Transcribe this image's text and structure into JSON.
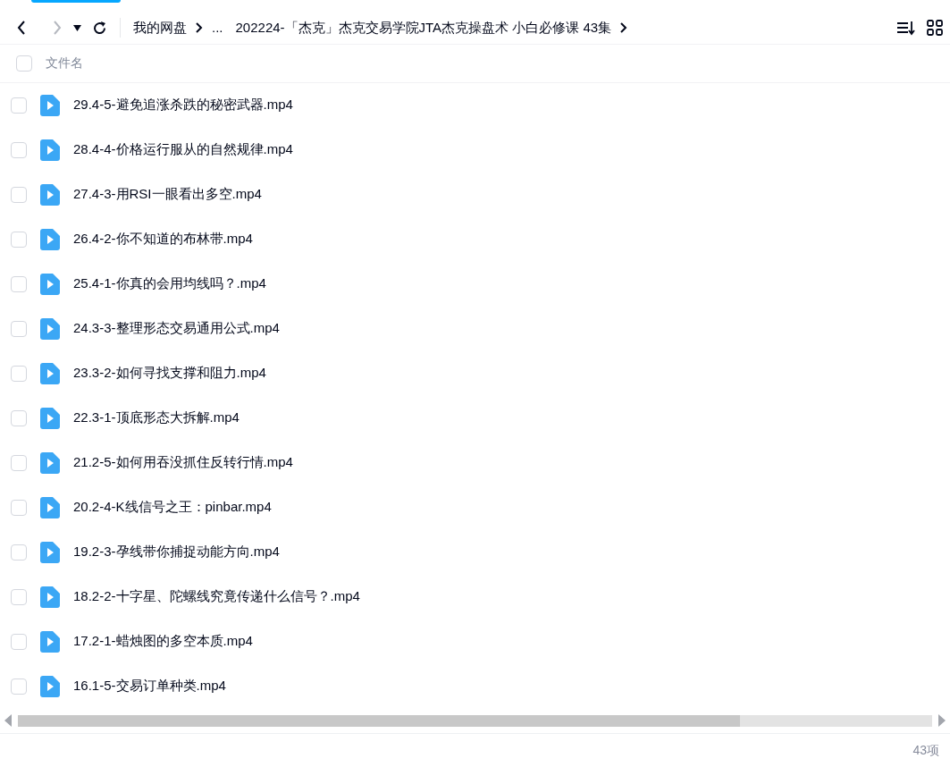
{
  "breadcrumb": [
    {
      "kind": "link",
      "label": "我的网盘"
    },
    {
      "kind": "ellipsis",
      "label": "..."
    },
    {
      "kind": "link",
      "label": "202224-「杰克」杰克交易学院JTA杰克操盘术 小白必修课 43集"
    }
  ],
  "header": {
    "checked": false,
    "column": "文件名"
  },
  "files": [
    {
      "name": "29.4-5-避免追涨杀跌的秘密武器.mp4",
      "checked": false
    },
    {
      "name": "28.4-4-价格运行服从的自然规律.mp4",
      "checked": false
    },
    {
      "name": "27.4-3-用RSI一眼看出多空.mp4",
      "checked": false
    },
    {
      "name": "26.4-2-你不知道的布林带.mp4",
      "checked": false
    },
    {
      "name": "25.4-1-你真的会用均线吗？.mp4",
      "checked": false
    },
    {
      "name": "24.3-3-整理形态交易通用公式.mp4",
      "checked": false
    },
    {
      "name": "23.3-2-如何寻找支撑和阻力.mp4",
      "checked": false
    },
    {
      "name": "22.3-1-顶底形态大拆解.mp4",
      "checked": false
    },
    {
      "name": "21.2-5-如何用吞没抓住反转行情.mp4",
      "checked": false
    },
    {
      "name": "20.2-4-K线信号之王：pinbar.mp4",
      "checked": false
    },
    {
      "name": "19.2-3-孕线带你捕捉动能方向.mp4",
      "checked": false
    },
    {
      "name": "18.2-2-十字星、陀螺线究竟传递什么信号？.mp4",
      "checked": false
    },
    {
      "name": "17.2-1-蜡烛图的多空本质.mp4",
      "checked": false
    },
    {
      "name": "16.1-5-交易订单种类.mp4",
      "checked": false
    }
  ],
  "scrollbar": {
    "level": 0.79
  },
  "status_bar": "43项"
}
